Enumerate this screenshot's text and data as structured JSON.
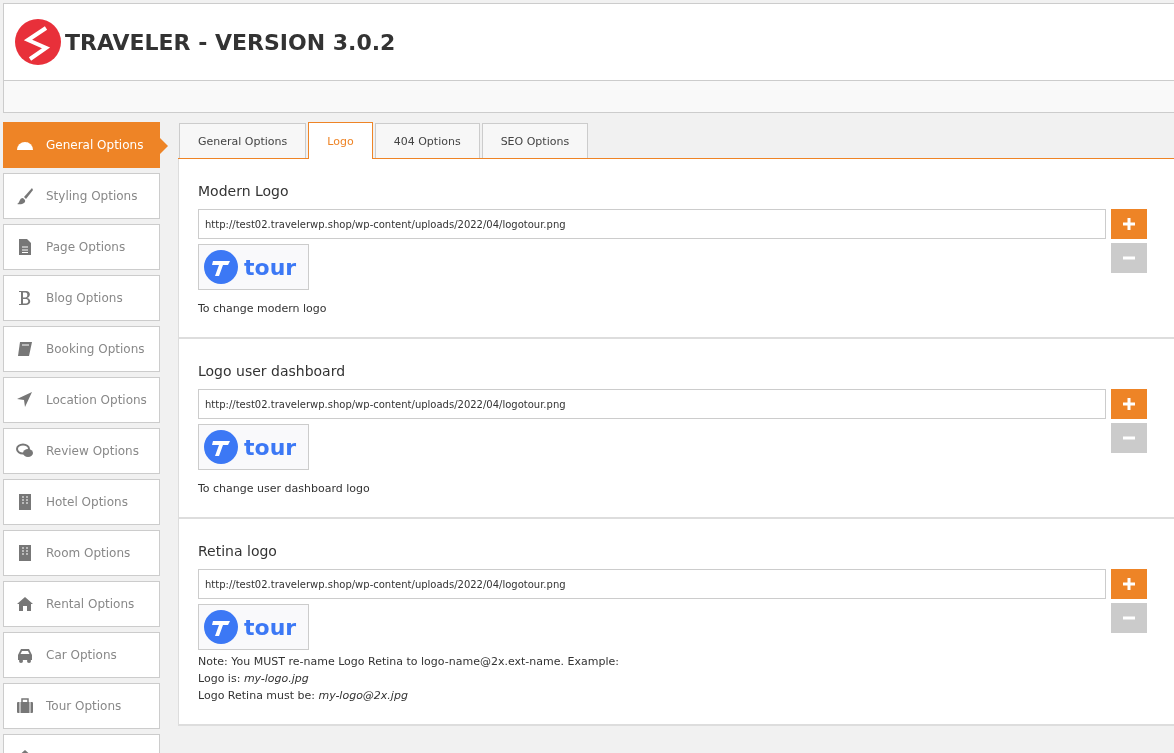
{
  "header": {
    "title": "TRAVELER - VERSION 3.0.2"
  },
  "sidebar": {
    "items": [
      {
        "label": "General Options",
        "selected": true
      },
      {
        "label": "Styling Options",
        "selected": false
      },
      {
        "label": "Page Options",
        "selected": false
      },
      {
        "label": "Blog Options",
        "selected": false
      },
      {
        "label": "Booking Options",
        "selected": false
      },
      {
        "label": "Location Options",
        "selected": false
      },
      {
        "label": "Review Options",
        "selected": false
      },
      {
        "label": "Hotel Options",
        "selected": false
      },
      {
        "label": "Room Options",
        "selected": false
      },
      {
        "label": "Rental Options",
        "selected": false
      },
      {
        "label": "Car Options",
        "selected": false
      },
      {
        "label": "Tour Options",
        "selected": false
      },
      {
        "selected": false
      }
    ]
  },
  "tabs": [
    {
      "label": "General Options",
      "selected": false
    },
    {
      "label": "Logo",
      "selected": true
    },
    {
      "label": "404 Options",
      "selected": false
    },
    {
      "label": "SEO Options",
      "selected": false
    }
  ],
  "sections": [
    {
      "title": "Modern Logo",
      "value": "http://test02.travelerwp.shop/wp-content/uploads/2022/04/logotour.png",
      "preview": "tour",
      "description": [
        "To change modern logo"
      ]
    },
    {
      "title": "Logo user dashboard",
      "value": "http://test02.travelerwp.shop/wp-content/uploads/2022/04/logotour.png",
      "preview": "tour",
      "description": [
        "To change user dashboard logo"
      ]
    },
    {
      "title": "Retina logo",
      "value": "http://test02.travelerwp.shop/wp-content/uploads/2022/04/logotour.png",
      "preview": "tour",
      "description": [
        "Note: You MUST re-name Logo Retina to logo-name@2x.ext-name. Example:",
        "Logo is: *my-logo.jpg*",
        "Logo Retina must be: *my-logo@2x.jpg*"
      ]
    }
  ]
}
